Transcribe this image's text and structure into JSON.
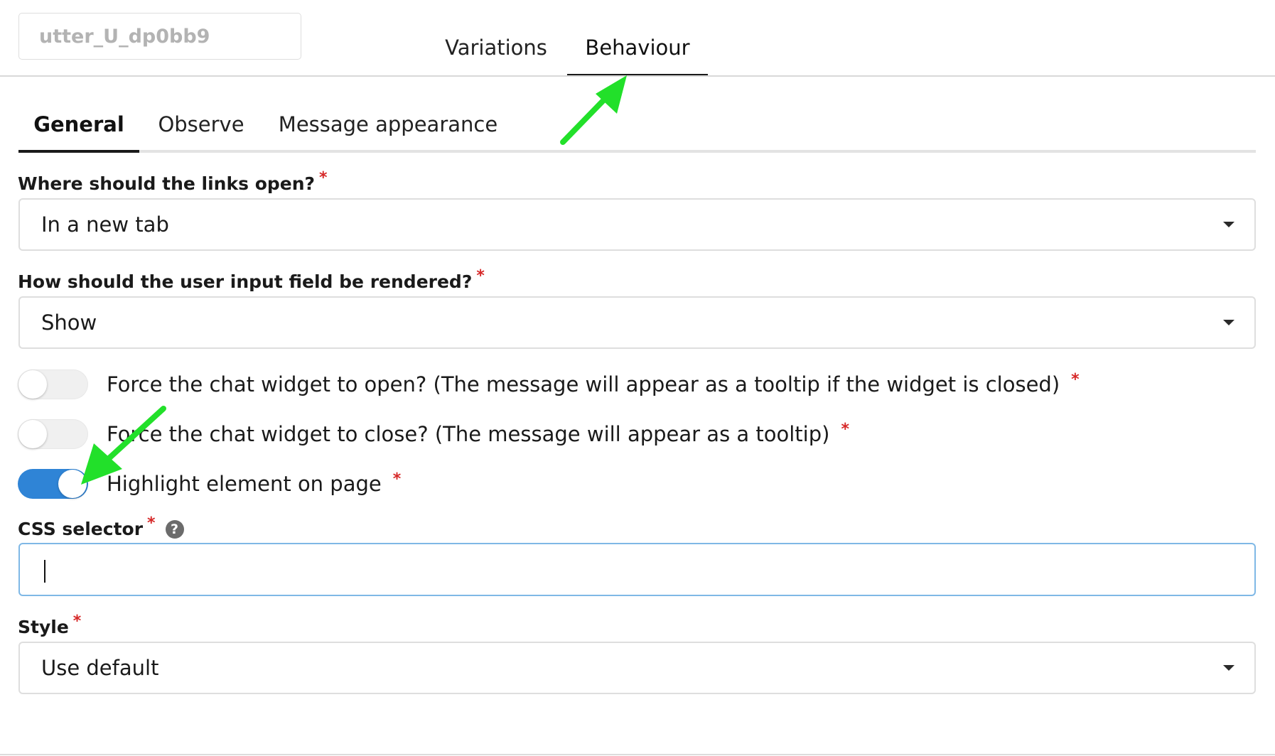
{
  "header": {
    "name_value": "utter_U_dp0bb9",
    "tabs": [
      {
        "label": "Variations"
      },
      {
        "label": "Behaviour"
      }
    ]
  },
  "sub_tabs": [
    {
      "label": "General"
    },
    {
      "label": "Observe"
    },
    {
      "label": "Message appearance"
    }
  ],
  "links_open": {
    "label": "Where should the links open?",
    "required_mark": "*",
    "value": "In a new tab"
  },
  "input_field": {
    "label": "How should the user input field be rendered?",
    "required_mark": "*",
    "value": "Show"
  },
  "toggles": [
    {
      "label": "Force the chat widget to open? (The message will appear as a tooltip if the widget is closed)",
      "required_mark": "*",
      "on": false
    },
    {
      "label": "Force the chat widget to close? (The message will appear as a tooltip)",
      "required_mark": "*",
      "on": false
    },
    {
      "label": "Highlight element on page",
      "required_mark": "*",
      "on": true
    }
  ],
  "css_selector": {
    "label": "CSS selector",
    "required_mark": "*",
    "help_glyph": "?",
    "value": ""
  },
  "style": {
    "label": "Style",
    "required_mark": "*",
    "value": "Use default"
  },
  "colors": {
    "toggle_on": "#2f84d6",
    "required": "#d62828",
    "annotation_arrow": "#22e02a",
    "focus_border": "#7fb8e6"
  }
}
